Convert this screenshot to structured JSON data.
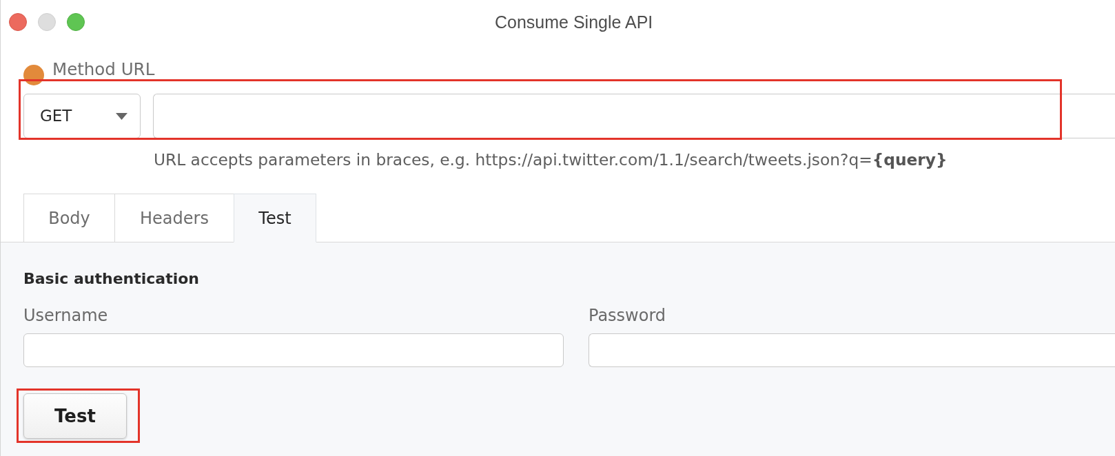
{
  "window": {
    "title": "Consume Single API"
  },
  "method_url": {
    "label": "Method URL",
    "method": "GET",
    "hint": "URL accepts parameters in braces, e.g. https://api.twitter.com/1.1/search/tweets.json?q=**{query}**"
  },
  "tabs": [
    {
      "label": "Body",
      "selected": false
    },
    {
      "label": "Headers",
      "selected": false
    },
    {
      "label": "Test",
      "selected": true
    }
  ],
  "auth": {
    "title": "Basic authentication",
    "fields": [
      {
        "label": "Username"
      },
      {
        "label": "Password"
      }
    ]
  },
  "test_button": {
    "label": "Test"
  }
}
